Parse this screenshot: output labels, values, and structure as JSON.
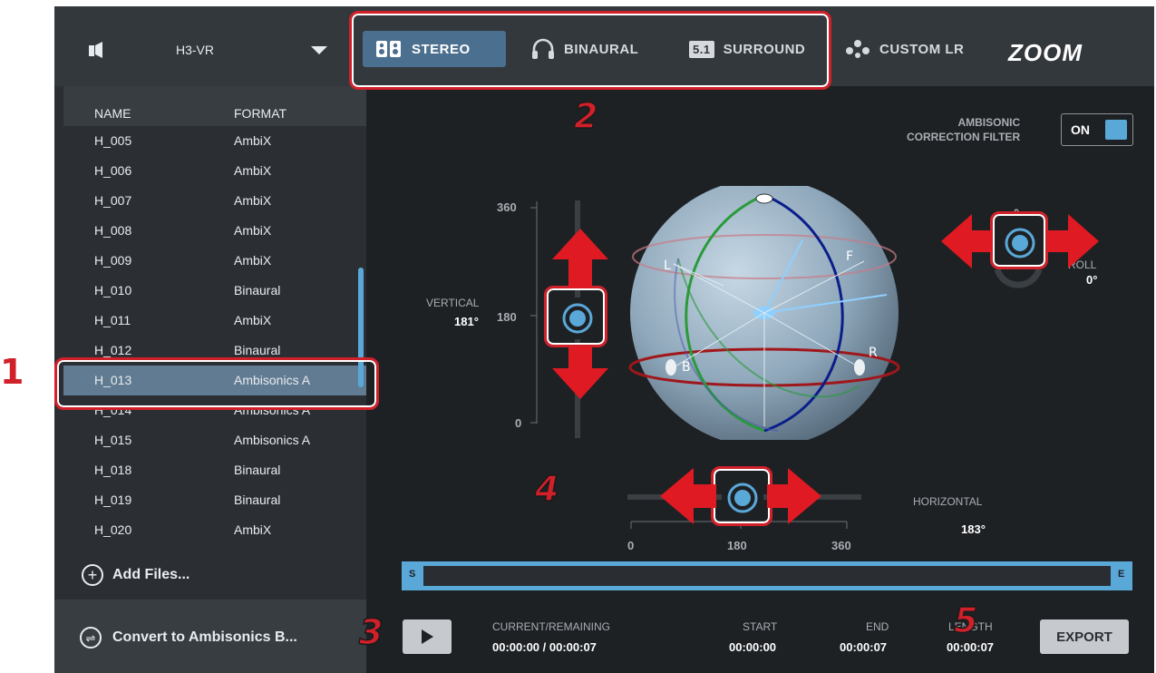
{
  "topbar": {
    "device": "H3-VR",
    "modes": [
      {
        "label": "STEREO",
        "icon": "speakers-icon",
        "active": true
      },
      {
        "label": "BINAURAL",
        "icon": "headphones-icon",
        "active": false
      },
      {
        "label": "SURROUND",
        "icon": "surround-51-icon",
        "badge": "5.1",
        "active": false
      }
    ],
    "custom_lr": "CUSTOM LR",
    "logo": "ZOOM"
  },
  "file_list": {
    "headers": {
      "name": "NAME",
      "format": "FORMAT"
    },
    "rows": [
      {
        "name": "H_005",
        "format": "AmbiX"
      },
      {
        "name": "H_006",
        "format": "AmbiX"
      },
      {
        "name": "H_007",
        "format": "AmbiX"
      },
      {
        "name": "H_008",
        "format": "AmbiX"
      },
      {
        "name": "H_009",
        "format": "AmbiX"
      },
      {
        "name": "H_010",
        "format": "Binaural"
      },
      {
        "name": "H_011",
        "format": "AmbiX"
      },
      {
        "name": "H_012",
        "format": "Binaural"
      },
      {
        "name": "H_013",
        "format": "Ambisonics A",
        "selected": true
      },
      {
        "name": "H_014",
        "format": "Ambisonics A"
      },
      {
        "name": "H_015",
        "format": "Ambisonics A"
      },
      {
        "name": "H_018",
        "format": "Binaural"
      },
      {
        "name": "H_019",
        "format": "Binaural"
      },
      {
        "name": "H_020",
        "format": "AmbiX"
      }
    ],
    "add_files": "Add Files...",
    "convert": "Convert to Ambisonics B..."
  },
  "ambisonic": {
    "label_line1": "AMBISONIC",
    "label_line2": "CORRECTION FILTER",
    "toggle": "ON"
  },
  "vertical": {
    "label": "VERTICAL",
    "value": "181°",
    "ticks": [
      "360",
      "180",
      "0"
    ]
  },
  "horizontal": {
    "label": "HORIZONTAL",
    "value": "183°",
    "ticks": [
      "0",
      "180",
      "360"
    ]
  },
  "roll": {
    "label": "ROLL",
    "value": "0°",
    "tick": "0"
  },
  "sphere_labels": {
    "left": "L",
    "right": "R",
    "back": "B",
    "front": "F"
  },
  "timeline": {
    "start_marker": "S",
    "end_marker": "E"
  },
  "transport": {
    "current_label": "CURRENT/REMAINING",
    "current_value": "00:00:00 / 00:00:07",
    "start_label": "START",
    "start_value": "00:00:00",
    "end_label": "END",
    "end_value": "00:00:07",
    "length_label": "LENGTH",
    "length_value": "00:00:07",
    "export": "EXPORT"
  },
  "callouts": [
    "1",
    "2",
    "3",
    "4",
    "5"
  ],
  "colors": {
    "accent": "#5aa8d8",
    "highlight": "#d0202a",
    "background": "#1e2124",
    "topbar": "#33383c"
  }
}
